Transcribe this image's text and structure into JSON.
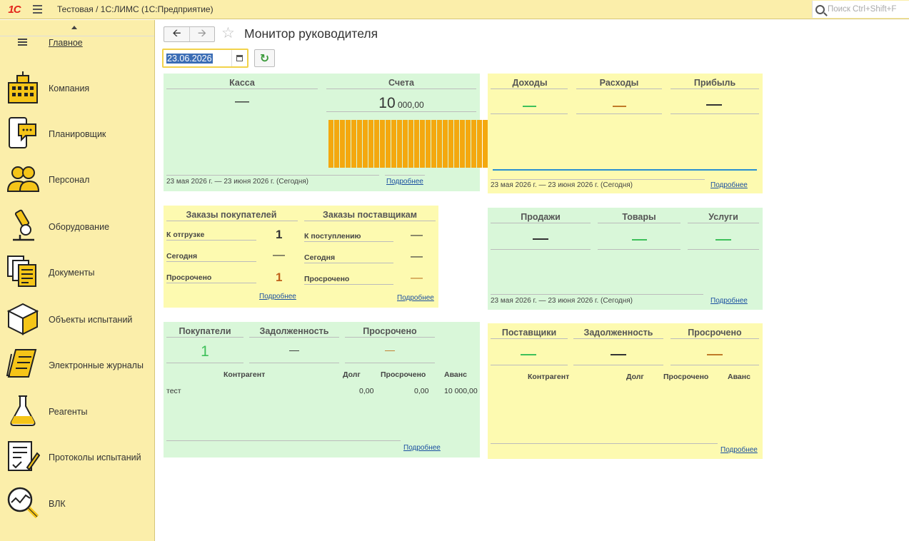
{
  "app": {
    "title": "Тестовая / 1С:ЛИМС  (1С:Предприятие)",
    "logo": "1С",
    "search_placeholder": "Поиск Ctrl+Shift+F"
  },
  "sidebar": {
    "items": [
      {
        "label": "Главное",
        "icon": "menu-lines-icon"
      },
      {
        "label": "Компания",
        "icon": "building-icon"
      },
      {
        "label": "Планировщик",
        "icon": "phone-chat-icon"
      },
      {
        "label": "Персонал",
        "icon": "people-icon"
      },
      {
        "label": "Оборудование",
        "icon": "microscope-icon"
      },
      {
        "label": "Документы",
        "icon": "documents-icon"
      },
      {
        "label": "Объекты испытаний",
        "icon": "box-icon"
      },
      {
        "label": "Электронные журналы",
        "icon": "journal-icon"
      },
      {
        "label": "Реагенты",
        "icon": "flask-icon"
      },
      {
        "label": "Протоколы испытаний",
        "icon": "protocol-icon"
      },
      {
        "label": "ВЛК",
        "icon": "magnifier-chart-icon"
      }
    ]
  },
  "page": {
    "title": "Монитор руководителя",
    "date": "23.06.2026"
  },
  "period_text": "23 мая 2026 г. — 23 июня 2026 г. (Сегодня)",
  "more_link": "Подробнее",
  "cash_accounts": {
    "kassa_label": "Касса",
    "kassa_value": "—",
    "accounts_label": "Счета",
    "accounts_value_main": "10",
    "accounts_value_rest": " 000,00",
    "bar_count": 28
  },
  "income": {
    "income_label": "Доходы",
    "expense_label": "Расходы",
    "profit_label": "Прибыль"
  },
  "orders": {
    "customers_title": "Заказы покупателей",
    "suppliers_title": "Заказы поставщикам",
    "customer_rows": [
      {
        "label": "К отгрузке",
        "value": "1"
      },
      {
        "label": "Сегодня",
        "value": "—"
      },
      {
        "label": "Просрочено",
        "value": "1"
      }
    ],
    "supplier_rows": [
      {
        "label": "К поступлению",
        "value": "—"
      },
      {
        "label": "Сегодня",
        "value": "—"
      },
      {
        "label": "Просрочено",
        "value": "—"
      }
    ]
  },
  "sales": {
    "sales_label": "Продажи",
    "goods_label": "Товары",
    "services_label": "Услуги"
  },
  "buyers": {
    "buyers_label": "Покупатели",
    "debt_label": "Задолженность",
    "overdue_label": "Просрочено",
    "buyers_value": "1",
    "debt_value": "—",
    "overdue_value": "—",
    "columns": [
      "Контрагент",
      "Долг",
      "Просрочено",
      "Аванс"
    ],
    "rows": [
      {
        "name": "тест",
        "debt": "0,00",
        "overdue": "0,00",
        "advance": "10 000,00"
      }
    ]
  },
  "suppliers": {
    "suppliers_label": "Поставщики",
    "debt_label": "Задолженность",
    "overdue_label": "Просрочено",
    "columns": [
      "Контрагент",
      "Долг",
      "Просрочено",
      "Аванс"
    ]
  },
  "colors": {
    "green_dash": "#3ec05a",
    "orange_dash": "#c07a28",
    "dark_dash": "#333333",
    "bar": "#f4a80f",
    "link": "#1a4fa0"
  }
}
